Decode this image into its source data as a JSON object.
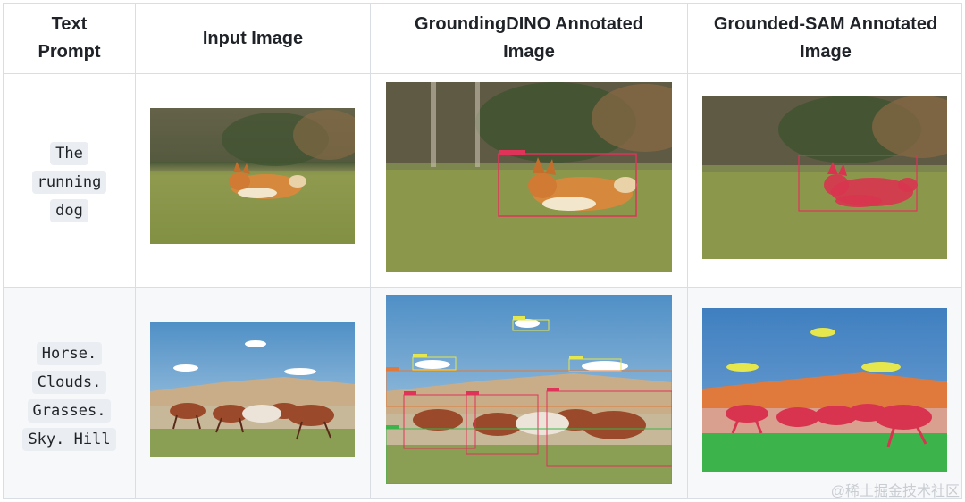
{
  "table": {
    "headers": [
      {
        "lines": [
          "Text",
          "Prompt"
        ]
      },
      {
        "lines": [
          "Input Image"
        ]
      },
      {
        "lines": [
          "GroundingDINO Annotated",
          "Image"
        ]
      },
      {
        "lines": [
          "Grounded-SAM Annotated",
          "Image"
        ]
      }
    ],
    "rows": [
      {
        "prompt_tokens": [
          "The",
          "running",
          "dog"
        ],
        "images": {
          "input": "corgi running on grass",
          "groundingdino": "corgi with red bounding box",
          "grounded_sam": "corgi with red segmentation mask"
        }
      },
      {
        "prompt_tokens": [
          "Horse.",
          "Clouds.",
          "Grasses.",
          "Sky. Hill"
        ],
        "images": {
          "input": "herd of horses galloping",
          "groundingdino": "horses with colored bounding boxes",
          "grounded_sam": "horses with colored segmentation masks"
        }
      }
    ]
  },
  "colors": {
    "border": "#d8dee4",
    "code_bg": "#eaedf1",
    "box_red": "#e0335a",
    "box_yellow": "#e6e64d",
    "box_orange": "#e07a3c",
    "box_green": "#3cb44b",
    "mask_red": "#d8344f"
  },
  "watermark": "@稀土掘金技术社区"
}
